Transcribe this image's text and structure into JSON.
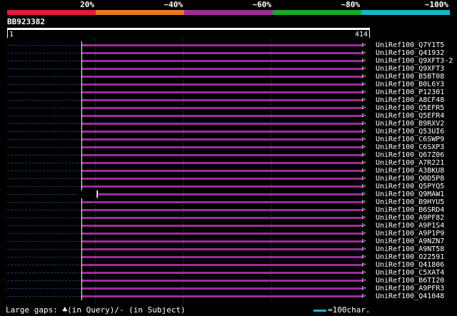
{
  "legend": {
    "labels": [
      "20%",
      "~40%",
      "~60%",
      "~80%",
      "~100%"
    ],
    "colors": [
      "#e8183a",
      "#e07c1f",
      "#9b2d9b",
      "#1ea327",
      "#17b6c6"
    ]
  },
  "query": {
    "id": "BB923382",
    "start": "1",
    "end": "414",
    "length": 414
  },
  "hits": [
    {
      "id": "UniRef100_Q7Y1T5",
      "start": 85,
      "end": 414
    },
    {
      "id": "UniRef100_Q41932",
      "start": 85,
      "end": 414
    },
    {
      "id": "UniRef100_Q9XFT3-2",
      "start": 85,
      "end": 414
    },
    {
      "id": "UniRef100_Q9XFT3",
      "start": 85,
      "end": 414
    },
    {
      "id": "UniRef100_B5BT08",
      "start": 85,
      "end": 414
    },
    {
      "id": "UniRef100_B0L6Y3",
      "start": 85,
      "end": 414
    },
    {
      "id": "UniRef100_P12301",
      "start": 85,
      "end": 414
    },
    {
      "id": "UniRef100_A8CF48",
      "start": 85,
      "end": 414
    },
    {
      "id": "UniRef100_Q5EFR5",
      "start": 85,
      "end": 414
    },
    {
      "id": "UniRef100_Q5EFR4",
      "start": 85,
      "end": 414
    },
    {
      "id": "UniRef100_B9RXV2",
      "start": 85,
      "end": 414
    },
    {
      "id": "UniRef100_Q53UI6",
      "start": 85,
      "end": 414
    },
    {
      "id": "UniRef100_C6SWP9",
      "start": 85,
      "end": 414
    },
    {
      "id": "UniRef100_C6SXP3",
      "start": 85,
      "end": 414
    },
    {
      "id": "UniRef100_Q67Z06",
      "start": 85,
      "end": 414
    },
    {
      "id": "UniRef100_A7R221",
      "start": 85,
      "end": 414
    },
    {
      "id": "UniRef100_A3BKU8",
      "start": 85,
      "end": 414
    },
    {
      "id": "UniRef100_Q0D5P8",
      "start": 85,
      "end": 414
    },
    {
      "id": "UniRef100_Q5PYQ5",
      "start": 85,
      "end": 414
    },
    {
      "id": "UniRef100_Q9MAW1",
      "start": 103,
      "end": 414,
      "gap": true
    },
    {
      "id": "UniRef100_B9HYU5",
      "start": 85,
      "end": 414
    },
    {
      "id": "UniRef100_B6SRD4",
      "start": 85,
      "end": 414
    },
    {
      "id": "UniRef100_A9PF82",
      "start": 85,
      "end": 414
    },
    {
      "id": "UniRef100_A9P1S4",
      "start": 85,
      "end": 414
    },
    {
      "id": "UniRef100_A9P1P9",
      "start": 85,
      "end": 414
    },
    {
      "id": "UniRef100_A9NZN7",
      "start": 85,
      "end": 414
    },
    {
      "id": "UniRef100_A9NT58",
      "start": 85,
      "end": 414
    },
    {
      "id": "UniRef100_O22591",
      "start": 85,
      "end": 414
    },
    {
      "id": "UniRef100_Q41806",
      "start": 85,
      "end": 414
    },
    {
      "id": "UniRef100_C5XAT4",
      "start": 85,
      "end": 414
    },
    {
      "id": "UniRef100_B6TI20",
      "start": 85,
      "end": 414
    },
    {
      "id": "UniRef100_A9PFR3",
      "start": 85,
      "end": 414
    },
    {
      "id": "UniRef100_Q41048",
      "start": 85,
      "end": 414
    }
  ],
  "hit_color": "#9b2d9b",
  "footer": {
    "gaps_label": "Large gaps: ♣(in Query)/- (in Subject)",
    "scale_label": "=100char."
  }
}
